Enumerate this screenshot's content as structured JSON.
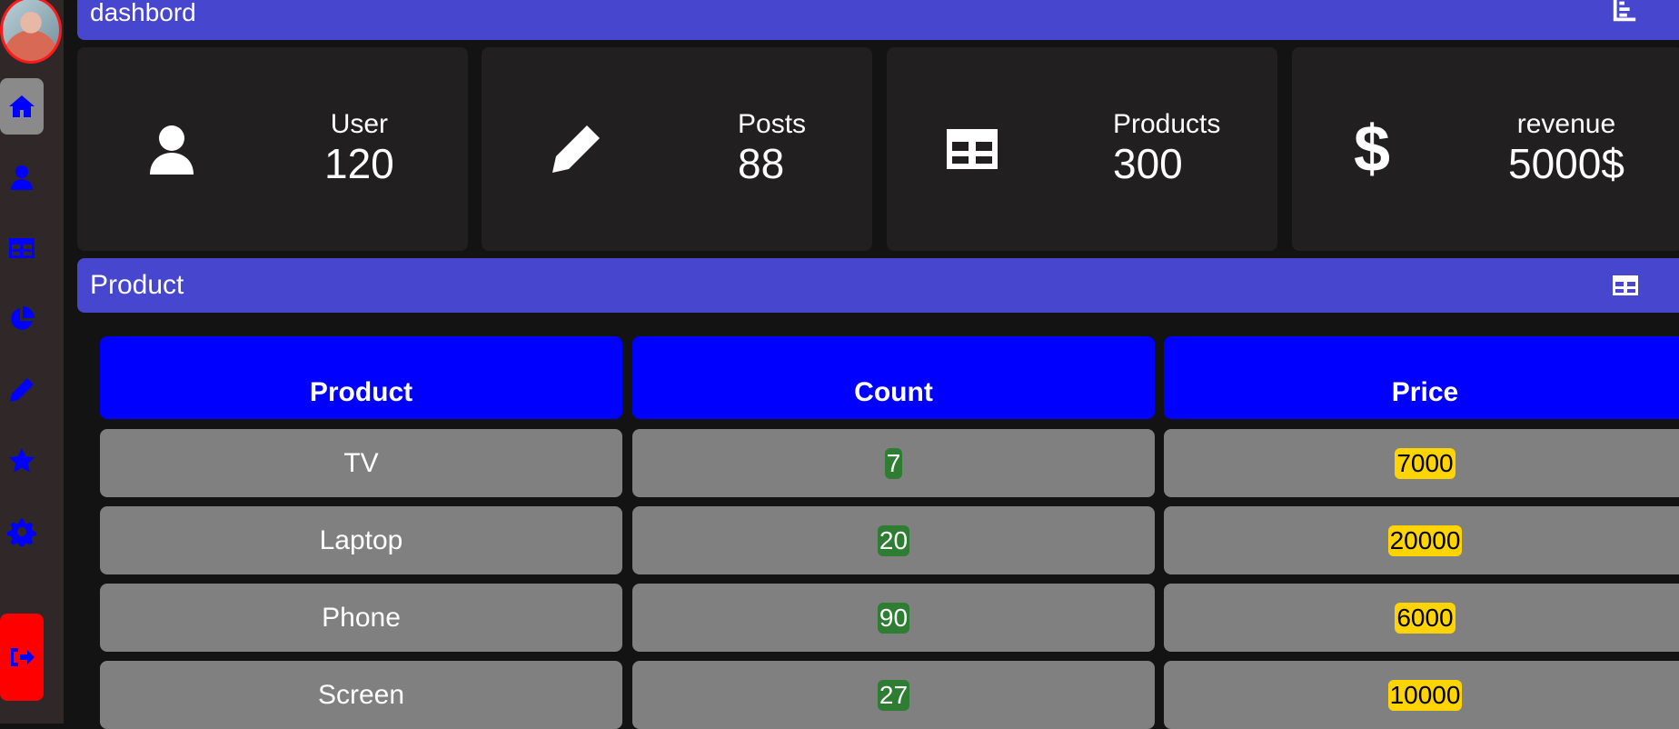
{
  "header": {
    "title": "dashbord",
    "icon": "bar-chart-icon"
  },
  "sidebar": {
    "items": [
      {
        "name": "home",
        "icon": "home-icon",
        "active": true
      },
      {
        "name": "users",
        "icon": "user-icon"
      },
      {
        "name": "table",
        "icon": "table-icon"
      },
      {
        "name": "chart",
        "icon": "pie-chart-icon"
      },
      {
        "name": "posts",
        "icon": "pencil-icon"
      },
      {
        "name": "favorites",
        "icon": "star-icon"
      },
      {
        "name": "settings",
        "icon": "gear-icon"
      }
    ],
    "logout_icon": "logout-icon"
  },
  "cards": [
    {
      "label": "User",
      "value": "120",
      "icon": "user-icon"
    },
    {
      "label": "Posts",
      "value": "88",
      "icon": "pencil-icon"
    },
    {
      "label": "Products",
      "value": "300",
      "icon": "table-icon"
    },
    {
      "label": "revenue",
      "value": "5000$",
      "icon": "dollar-icon"
    }
  ],
  "product_panel": {
    "title": "Product",
    "icon": "table-icon"
  },
  "table": {
    "headers": [
      "Product",
      "Count",
      "Price"
    ],
    "rows": [
      {
        "product": "TV",
        "count": "7",
        "price": "7000"
      },
      {
        "product": "Laptop",
        "count": "20",
        "price": "20000"
      },
      {
        "product": "Phone",
        "count": "90",
        "price": "6000"
      },
      {
        "product": "Screen",
        "count": "27",
        "price": "10000"
      }
    ]
  },
  "colors": {
    "accent_bar": "#4646cf",
    "table_header": "#0000ff",
    "sidebar_icon": "#0000ff",
    "count_badge": "#2e7d32",
    "price_badge": "#ffd400",
    "logout": "#ff0000"
  }
}
